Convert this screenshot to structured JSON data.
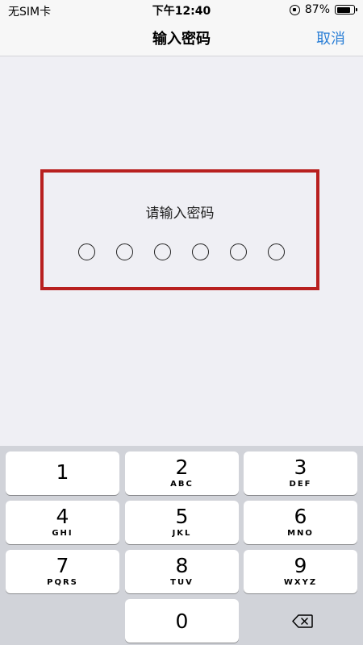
{
  "status": {
    "carrier": "无SIM卡",
    "time": "下午12:40",
    "battery": "87%",
    "battery_level": 0.87
  },
  "nav": {
    "title": "输入密码",
    "cancel": "取消"
  },
  "password": {
    "prompt": "请输入密码",
    "length": 6
  },
  "keypad": {
    "keys": [
      {
        "num": "1",
        "letters": ""
      },
      {
        "num": "2",
        "letters": "ABC"
      },
      {
        "num": "3",
        "letters": "DEF"
      },
      {
        "num": "4",
        "letters": "GHI"
      },
      {
        "num": "5",
        "letters": "JKL"
      },
      {
        "num": "6",
        "letters": "MNO"
      },
      {
        "num": "7",
        "letters": "PQRS"
      },
      {
        "num": "8",
        "letters": "TUV"
      },
      {
        "num": "9",
        "letters": "WXYZ"
      },
      {
        "num": "0",
        "letters": ""
      }
    ],
    "delete_icon": "backspace-icon"
  },
  "colors": {
    "accent": "#2b7fd6",
    "highlight_border": "#b8201f",
    "keypad_bg": "#d1d3d9"
  }
}
